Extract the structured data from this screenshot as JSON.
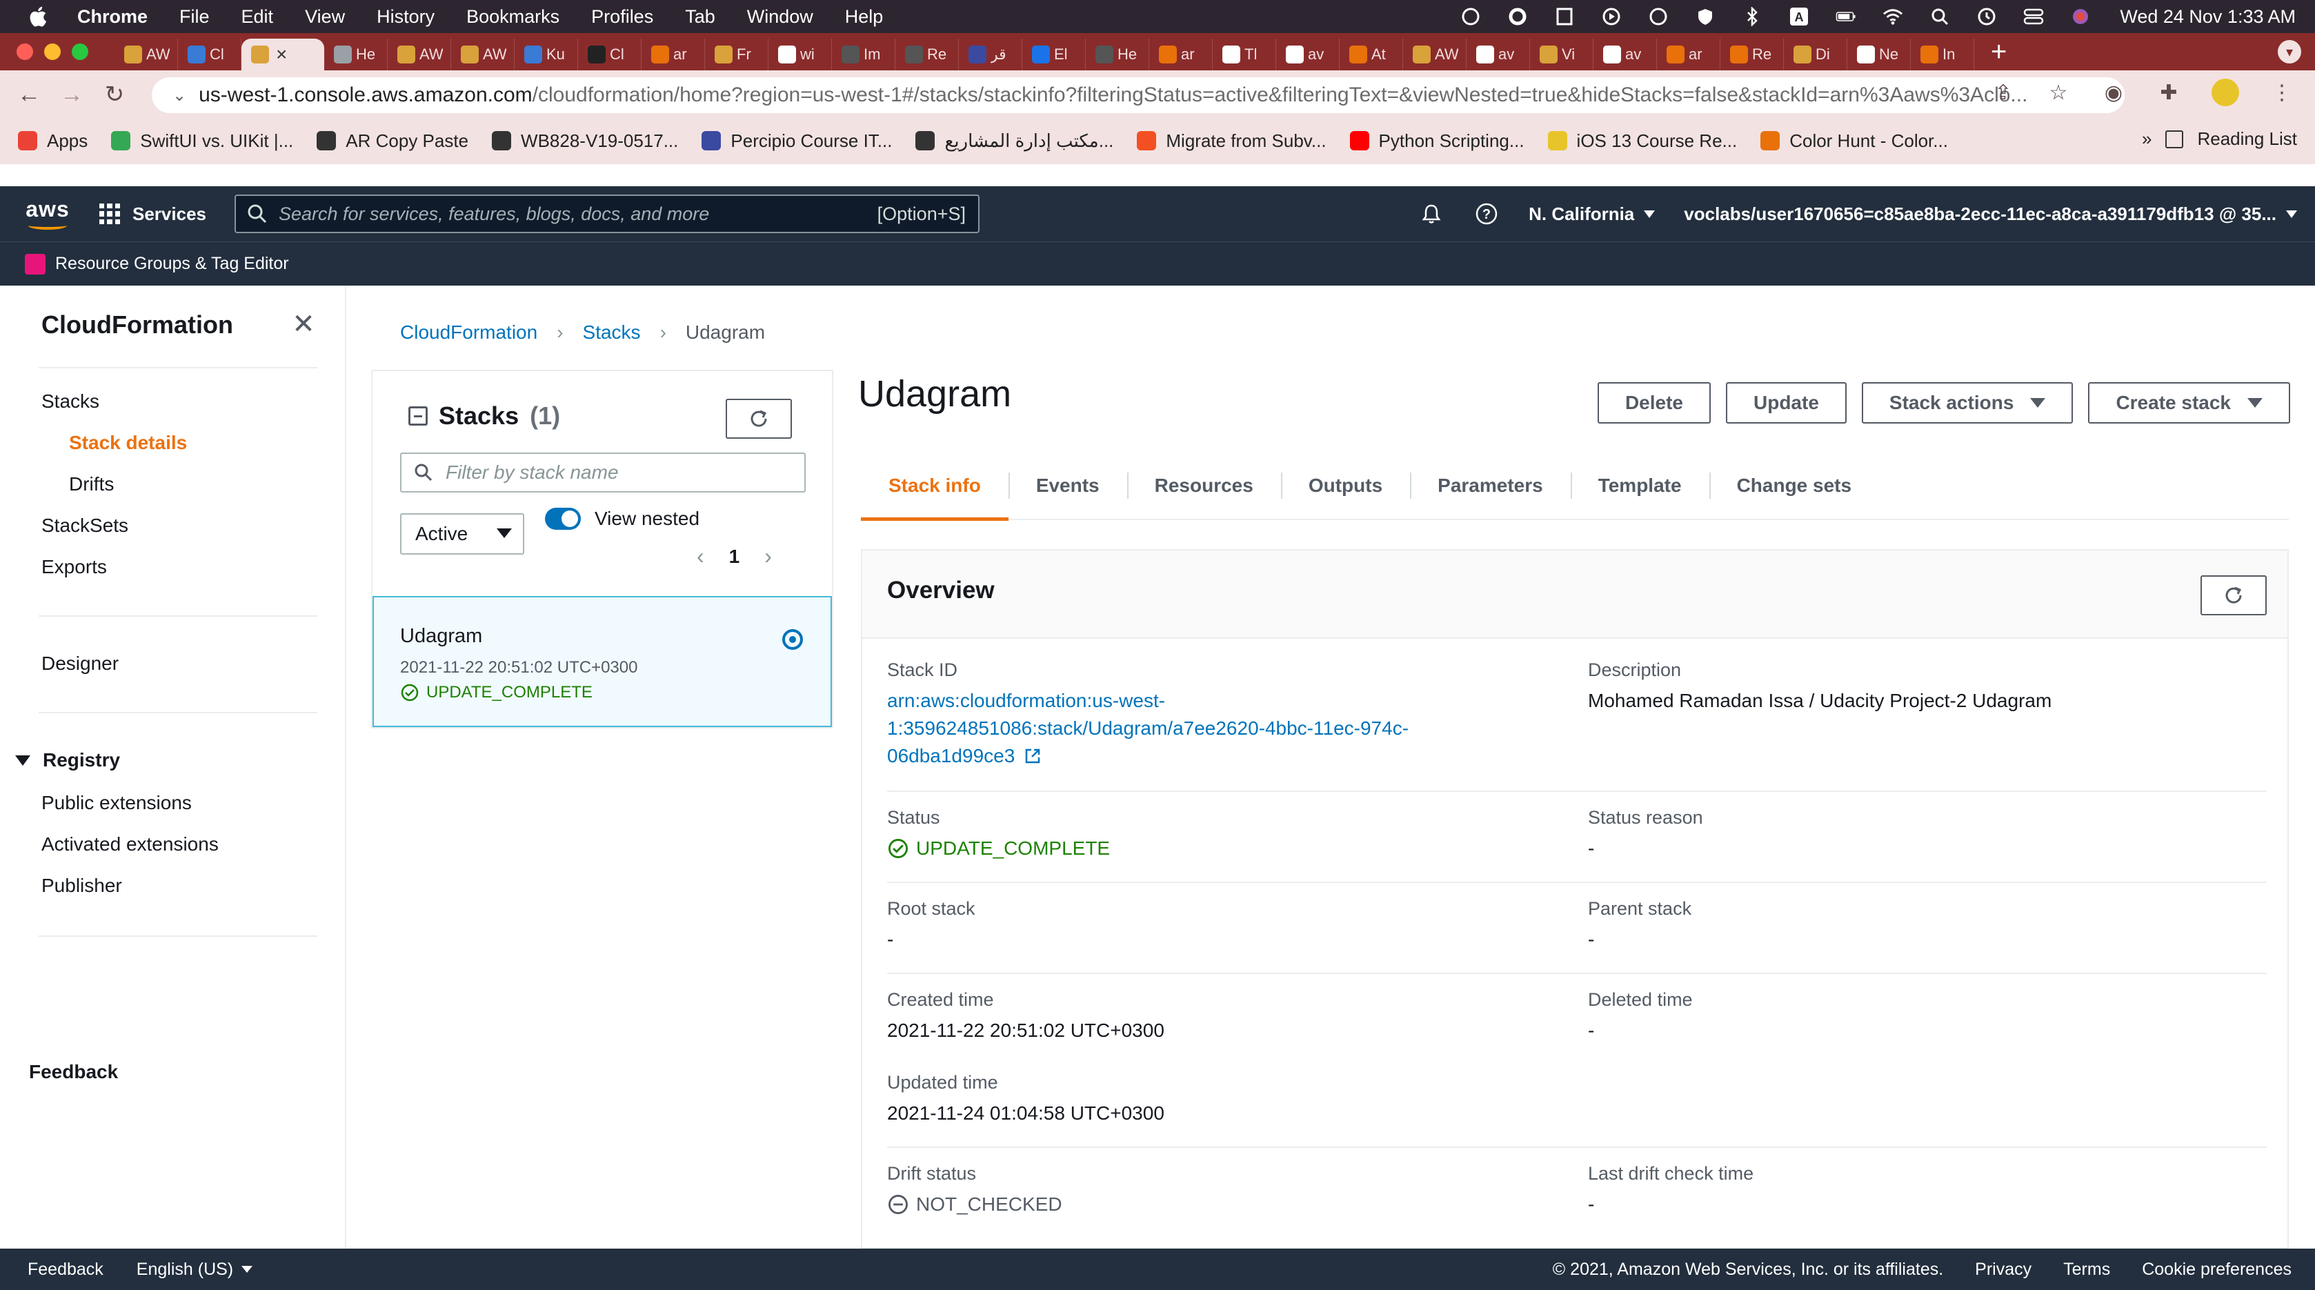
{
  "menubar": {
    "app": "Chrome",
    "items": [
      "File",
      "Edit",
      "View",
      "History",
      "Bookmarks",
      "Profiles",
      "Tab",
      "Window",
      "Help"
    ],
    "clock": "Wed 24 Nov  1:33 AM"
  },
  "tabs": [
    {
      "title": "AW",
      "color": "#d9a23a"
    },
    {
      "title": "Cl",
      "color": "#3a7bd5"
    },
    {
      "title": "",
      "color": "#d9a23a",
      "active": true
    },
    {
      "title": "He",
      "color": "#9aa0a6"
    },
    {
      "title": "AW",
      "color": "#d9a23a"
    },
    {
      "title": "AW",
      "color": "#d9a23a"
    },
    {
      "title": "Ku",
      "color": "#3a7bd5"
    },
    {
      "title": "Cl",
      "color": "#222222"
    },
    {
      "title": "ar",
      "color": "#e8710a"
    },
    {
      "title": "Fr",
      "color": "#d9a23a"
    },
    {
      "title": "wi",
      "color": "#ffffff"
    },
    {
      "title": "Im",
      "color": "#555555"
    },
    {
      "title": "Re",
      "color": "#555555"
    },
    {
      "title": "قر",
      "color": "#3a4aa0"
    },
    {
      "title": "El",
      "color": "#1a73e8"
    },
    {
      "title": "He",
      "color": "#555555"
    },
    {
      "title": "ar",
      "color": "#e8710a"
    },
    {
      "title": "Tl",
      "color": "#ffffff"
    },
    {
      "title": "av",
      "color": "#ffffff"
    },
    {
      "title": "At",
      "color": "#e8710a"
    },
    {
      "title": "AW",
      "color": "#d9a23a"
    },
    {
      "title": "av",
      "color": "#ffffff"
    },
    {
      "title": "Vi",
      "color": "#d9a23a"
    },
    {
      "title": "av",
      "color": "#ffffff"
    },
    {
      "title": "ar",
      "color": "#e8710a"
    },
    {
      "title": "Re",
      "color": "#e8710a"
    },
    {
      "title": "Di",
      "color": "#d9a23a"
    },
    {
      "title": "Ne",
      "color": "#ffffff"
    },
    {
      "title": "In",
      "color": "#e8710a"
    }
  ],
  "url": {
    "host": "us-west-1.console.aws.amazon.com",
    "path": "/cloudformation/home?region=us-west-1#/stacks/stackinfo?filteringStatus=active&filteringText=&viewNested=true&hideStacks=false&stackId=arn%3Aaws%3Aclo..."
  },
  "bookmarks": [
    {
      "label": "Apps",
      "color": "#ea4335"
    },
    {
      "label": "SwiftUI vs. UIKit |...",
      "color": "#34a853"
    },
    {
      "label": "AR Copy Paste",
      "color": "#333333"
    },
    {
      "label": "WB828-V19-0517...",
      "color": "#333333"
    },
    {
      "label": "Percipio Course IT...",
      "color": "#3a4aa0"
    },
    {
      "label": "مكتب إدارة المشاريع...",
      "color": "#333333"
    },
    {
      "label": "Migrate from Subv...",
      "color": "#f25022"
    },
    {
      "label": "Python Scripting...",
      "color": "#ff0000"
    },
    {
      "label": "iOS 13 Course Re...",
      "color": "#e8c42b"
    },
    {
      "label": "Color Hunt - Color...",
      "color": "#e8710a"
    }
  ],
  "reading_list": "Reading List",
  "aws": {
    "logo": "aws",
    "services": "Services",
    "search_placeholder": "Search for services, features, blogs, docs, and more",
    "search_shortcut": "[Option+S]",
    "region": "N. California",
    "account": "voclabs/user1670656=c85ae8ba-2ecc-11ec-a8ca-a391179dfb13 @ 35...",
    "resource_groups": "Resource Groups & Tag Editor"
  },
  "sidebar": {
    "title": "CloudFormation",
    "items": [
      "Stacks",
      "Stack details",
      "Drifts",
      "StackSets",
      "Exports"
    ],
    "designer": "Designer",
    "registry": "Registry",
    "registry_items": [
      "Public extensions",
      "Activated extensions",
      "Publisher"
    ],
    "feedback": "Feedback"
  },
  "breadcrumb": [
    "CloudFormation",
    "Stacks",
    "Udagram"
  ],
  "stacks_panel": {
    "title": "Stacks",
    "count": "(1)",
    "filter_placeholder": "Filter by stack name",
    "status_filter": "Active",
    "view_nested": "View nested",
    "page": "1",
    "stack": {
      "name": "Udagram",
      "time": "2021-11-22 20:51:02 UTC+0300",
      "status": "UPDATE_COMPLETE"
    }
  },
  "detail": {
    "title": "Udagram",
    "actions": [
      "Delete",
      "Update",
      "Stack actions",
      "Create stack"
    ],
    "tabs": [
      "Stack info",
      "Events",
      "Resources",
      "Outputs",
      "Parameters",
      "Template",
      "Change sets"
    ]
  },
  "overview": {
    "title": "Overview",
    "stack_id_label": "Stack ID",
    "stack_id_lines": [
      "arn:aws:cloudformation:us-west-",
      "1:359624851086:stack/Udagram/a7ee2620-4bbc-11ec-974c-",
      "06dba1d99ce3"
    ],
    "description_label": "Description",
    "description": "Mohamed Ramadan Issa / Udacity Project-2 Udagram",
    "status_label": "Status",
    "status": "UPDATE_COMPLETE",
    "status_reason_label": "Status reason",
    "status_reason": "-",
    "root_stack_label": "Root stack",
    "root_stack": "-",
    "parent_stack_label": "Parent stack",
    "parent_stack": "-",
    "created_label": "Created time",
    "created": "2021-11-22 20:51:02 UTC+0300",
    "deleted_label": "Deleted time",
    "deleted": "-",
    "updated_label": "Updated time",
    "updated": "2021-11-24 01:04:58 UTC+0300",
    "drift_label": "Drift status",
    "drift": "NOT_CHECKED",
    "last_drift_label": "Last drift check time",
    "last_drift": "-"
  },
  "footer": {
    "feedback": "Feedback",
    "language": "English (US)",
    "copyright": "© 2021, Amazon Web Services, Inc. or its affiliates.",
    "links": [
      "Privacy",
      "Terms",
      "Cookie preferences"
    ]
  }
}
